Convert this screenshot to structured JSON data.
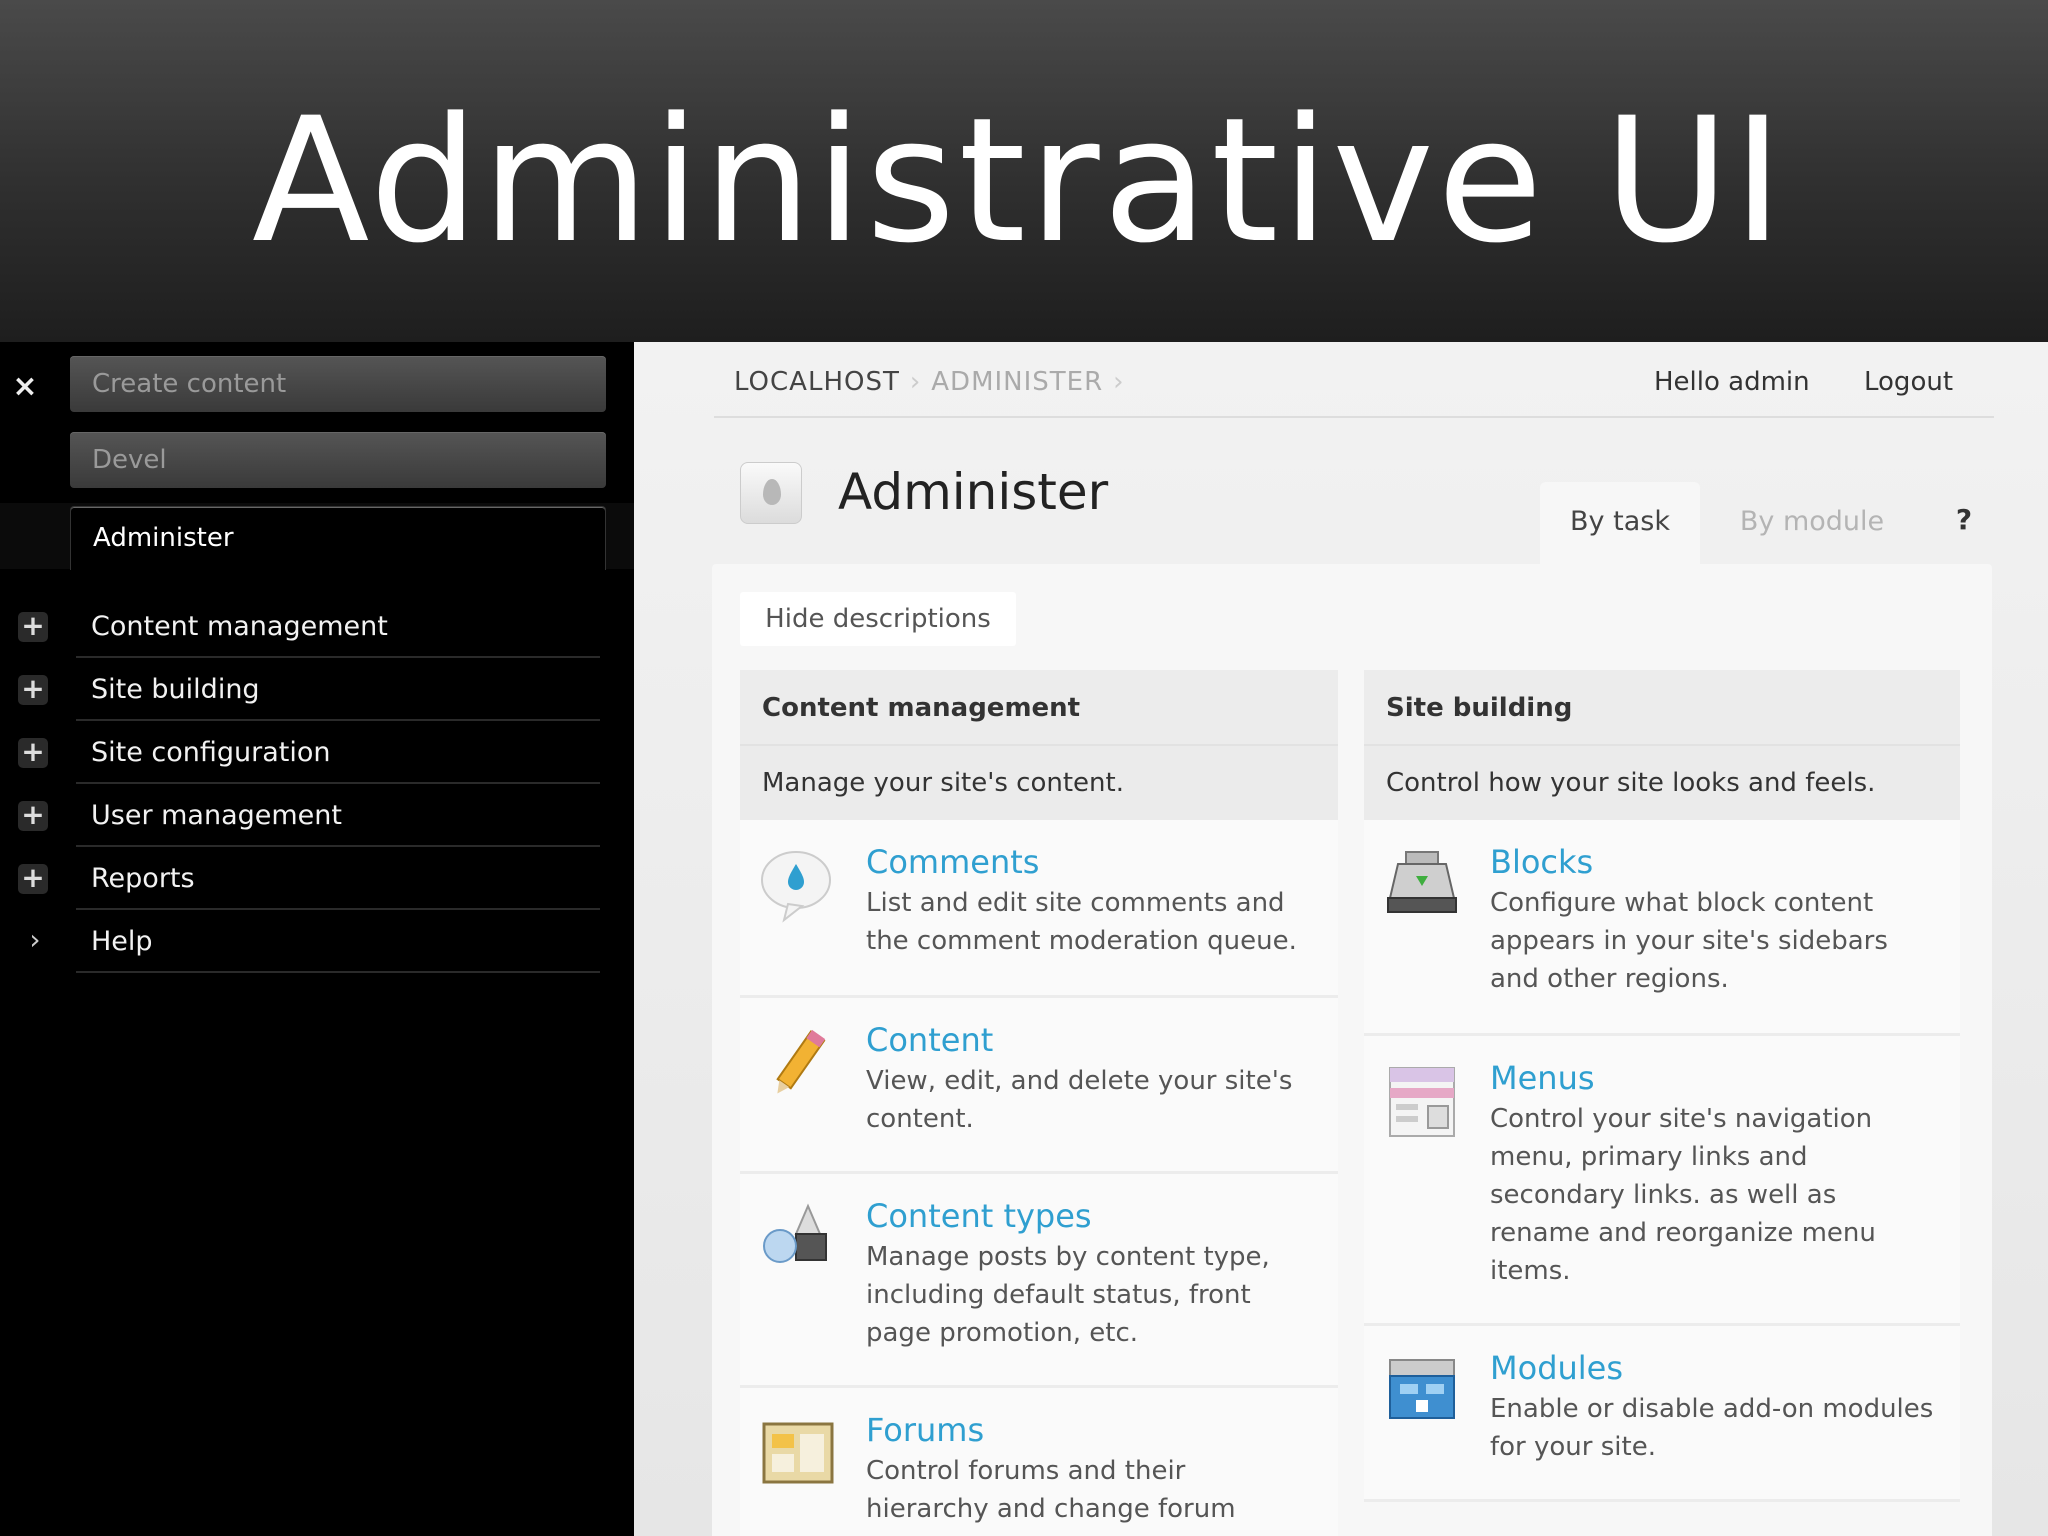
{
  "slide": {
    "title": "Administrative UI"
  },
  "sidebar": {
    "close_label": "×",
    "top_tabs": [
      {
        "label": "Create content"
      },
      {
        "label": "Devel"
      },
      {
        "label": "Administer"
      }
    ],
    "items": [
      {
        "label": "Content management",
        "icon": "plus-icon"
      },
      {
        "label": "Site building",
        "icon": "plus-icon"
      },
      {
        "label": "Site configuration",
        "icon": "plus-icon"
      },
      {
        "label": "User management",
        "icon": "plus-icon"
      },
      {
        "label": "Reports",
        "icon": "plus-icon"
      },
      {
        "label": "Help",
        "icon": "chevron-right-icon"
      }
    ]
  },
  "header": {
    "breadcrumb": [
      "LOCALHOST",
      "ADMINISTER"
    ],
    "hello": "Hello admin",
    "logout": "Logout"
  },
  "page": {
    "title": "Administer",
    "tabs": {
      "by_task": "By task",
      "by_module": "By module",
      "help": "?"
    },
    "hide_descriptions": "Hide descriptions"
  },
  "columns": {
    "left": {
      "title": "Content management",
      "description": "Manage your site's content.",
      "items": [
        {
          "title": "Comments",
          "description": "List and edit site comments and the comment moderation queue.",
          "icon": "comment-bubble-icon"
        },
        {
          "title": "Content",
          "description": "View, edit, and delete your site's content.",
          "icon": "pencil-icon"
        },
        {
          "title": "Content types",
          "description": "Manage posts by content type, including default status, front page promotion, etc.",
          "icon": "shapes-icon"
        },
        {
          "title": "Forums",
          "description": "Control forums and their hierarchy and change forum",
          "icon": "forum-board-icon"
        }
      ]
    },
    "right": {
      "title": "Site building",
      "description": "Control how your site looks and feels.",
      "items": [
        {
          "title": "Blocks",
          "description": "Configure what block content appears in your site's sidebars and other regions.",
          "icon": "block-tray-icon"
        },
        {
          "title": "Menus",
          "description": "Control your site's navigation menu, primary links and secondary links. as well as rename and reorganize menu items.",
          "icon": "menu-window-icon"
        },
        {
          "title": "Modules",
          "description": "Enable or disable add-on modules for your site.",
          "icon": "module-toolbox-icon"
        }
      ]
    }
  },
  "colors": {
    "link": "#2f9fd0",
    "sidebar_bg": "#000000",
    "panel_bg": "#f2f2f2"
  }
}
